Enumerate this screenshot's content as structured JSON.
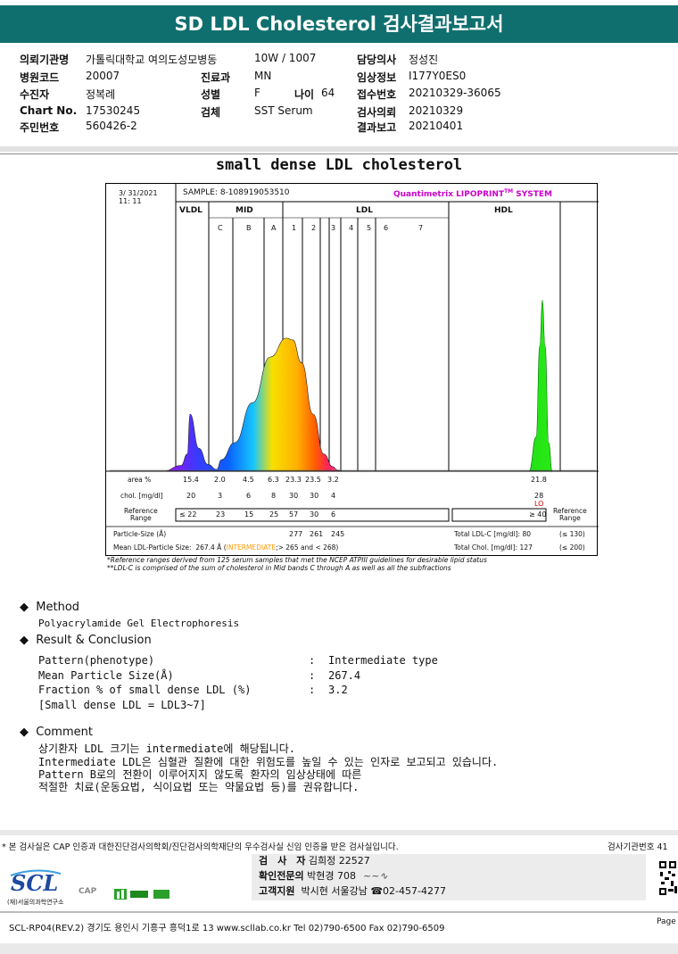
{
  "header": {
    "title": "SD LDL Cholesterol 검사결과보고서"
  },
  "info": {
    "col1": [
      {
        "label": "의뢰기관명",
        "value": "가톨릭대학교 여의도성모병동"
      },
      {
        "label": "병원코드",
        "value": "20007"
      },
      {
        "label": "수진자",
        "value": "정복례"
      },
      {
        "label": "Chart No.",
        "value": "17530245"
      },
      {
        "label": "주민번호",
        "value": "560426-2"
      }
    ],
    "ward": "10W / 1007",
    "dept": {
      "label": "진료과",
      "value": "MN"
    },
    "sex": {
      "label": "성별",
      "value": "F"
    },
    "age": {
      "label": "나이",
      "value": "64"
    },
    "specimen": {
      "label": "검체",
      "value": "SST Serum"
    },
    "col3": [
      {
        "label": "담당의사",
        "value": "정성진"
      },
      {
        "label": "임상정보",
        "value": "I177Y0ES0"
      },
      {
        "label": "접수번호",
        "value": "20210329-36065"
      },
      {
        "label": "검사의뢰",
        "value": "20210329"
      },
      {
        "label": "결과보고",
        "value": "20210401"
      }
    ]
  },
  "report_title": "small dense LDL cholesterol",
  "chart_data": {
    "type": "area",
    "title": "SAMPLE: 8-108919053510",
    "date": "3/ 31/2021",
    "time": "11: 11",
    "brand": "Quantimetrix LIPOPRINT",
    "brand_tm": "TM",
    "brand_suffix": " SYSTEM",
    "groups": [
      "VLDL",
      "MID",
      "LDL",
      "HDL"
    ],
    "bands": [
      "C",
      "B",
      "A",
      "1",
      "2",
      "3",
      "4",
      "5",
      "6",
      "7"
    ],
    "area_label": "area %",
    "area_values": [
      "15.4",
      "2.0",
      "4.5",
      "6.3",
      "23.3",
      "23.5",
      "3.2",
      "21.8"
    ],
    "chol_label": "chol. [mg/dl]",
    "chol_values": [
      "20",
      "3",
      "6",
      "8",
      "30",
      "30",
      "4",
      "28"
    ],
    "hdl_flag": "LO",
    "ref_label_1": "Reference",
    "ref_label_2": "Range",
    "ref_values": [
      "≤ 22",
      "23",
      "15",
      "25",
      "57",
      "30",
      "6"
    ],
    "hdl_ref": "≥ 40",
    "particle_size_label": "Particle-Size (Å)",
    "particle_sizes": [
      "277",
      "261",
      "245"
    ],
    "total_ldl_label": "Total LDL-C [mg/dl]:",
    "total_ldl_value": "80",
    "total_ldl_ref": "(≤ 130)",
    "mean_size_label": "Mean LDL-Particle Size:",
    "mean_size_value": "267.4 Å",
    "mean_size_type": "INTERMEDIATE",
    "mean_size_ref": ";> 265 and < 268)",
    "total_chol_label": "Total Chol. [mg/dl]:",
    "total_chol_value": "127",
    "total_chol_ref": "(≤ 200)",
    "curve_x": [
      0,
      60,
      80,
      87,
      90,
      100,
      110,
      120,
      125,
      140,
      160,
      180,
      198,
      205,
      215,
      228,
      240,
      250,
      255,
      260,
      270,
      300,
      350,
      400,
      440,
      470,
      478,
      482,
      485,
      488,
      492,
      496,
      505,
      545
    ],
    "curve_y": [
      0,
      0,
      100,
      300,
      1000,
      400,
      120,
      30,
      200,
      500,
      1200,
      2000,
      2330,
      2300,
      1900,
      1000,
      300,
      80,
      20,
      5,
      2,
      0,
      0,
      0,
      0,
      0,
      600,
      2200,
      3000,
      2200,
      500,
      0,
      0,
      0
    ]
  },
  "footnotes": [
    "*Reference ranges derived from 125 serum samples that met the NCEP ATPIII guidelines for desirable lipid status",
    "**LDL-C is comprised of the sum of cholesterol in Mid bands C through A as well as all the subfractions"
  ],
  "method": {
    "heading": "Method",
    "text": "Polyacrylamide Gel Electrophoresis"
  },
  "result": {
    "heading": "Result & Conclusion",
    "rows": [
      {
        "label": "Pattern(phenotype)",
        "value": "Intermediate type"
      },
      {
        "label": "Mean Particle Size(Å)",
        "value": "267.4"
      },
      {
        "label": "Fraction % of small dense LDL (%)",
        "value": "3.2"
      }
    ],
    "note": "[Small dense LDL = LDL3~7]"
  },
  "comment": {
    "heading": "Comment",
    "lines": [
      "상기환자 LDL 크기는 intermediate에 해당됩니다.",
      "Intermediate LDL은 심혈관 질환에 대한 위험도를 높일 수 있는 인자로 보고되고 있습니다.",
      "Pattern B로의 전환이 이루어지지 않도록 환자의 임상상태에 따른",
      "적절한 치료(운동요법, 식이요법 또는 약물요법 등)를 권유합니다."
    ]
  },
  "footer": {
    "cert": "* 본 검사실은 CAP 인증과 대한진단검사의학회/진단검사의학재단의 우수검사실 신임 인증을 받은 검사실입니다.",
    "agency_no": "검사기관번호 41",
    "staff": [
      {
        "label": "검　사　자",
        "name": "김희정",
        "extra": "22527"
      },
      {
        "label": "확인전문의",
        "name": "박현경",
        "extra": "708"
      },
      {
        "label": "고객지원",
        "name": "박시현",
        "extra": "서울강남 ☎02-457-4277"
      }
    ],
    "logo": "SCL",
    "logo_sub": "(재)서울의과학연구소",
    "cap_logo": "CAP",
    "address": "SCL-RP04(REV.2)  경기도 용인시 기흥구 흥덕1로 13  www.scllab.co.kr  Tel 02)790-6500  Fax 02)790-6509",
    "page": "Page"
  }
}
